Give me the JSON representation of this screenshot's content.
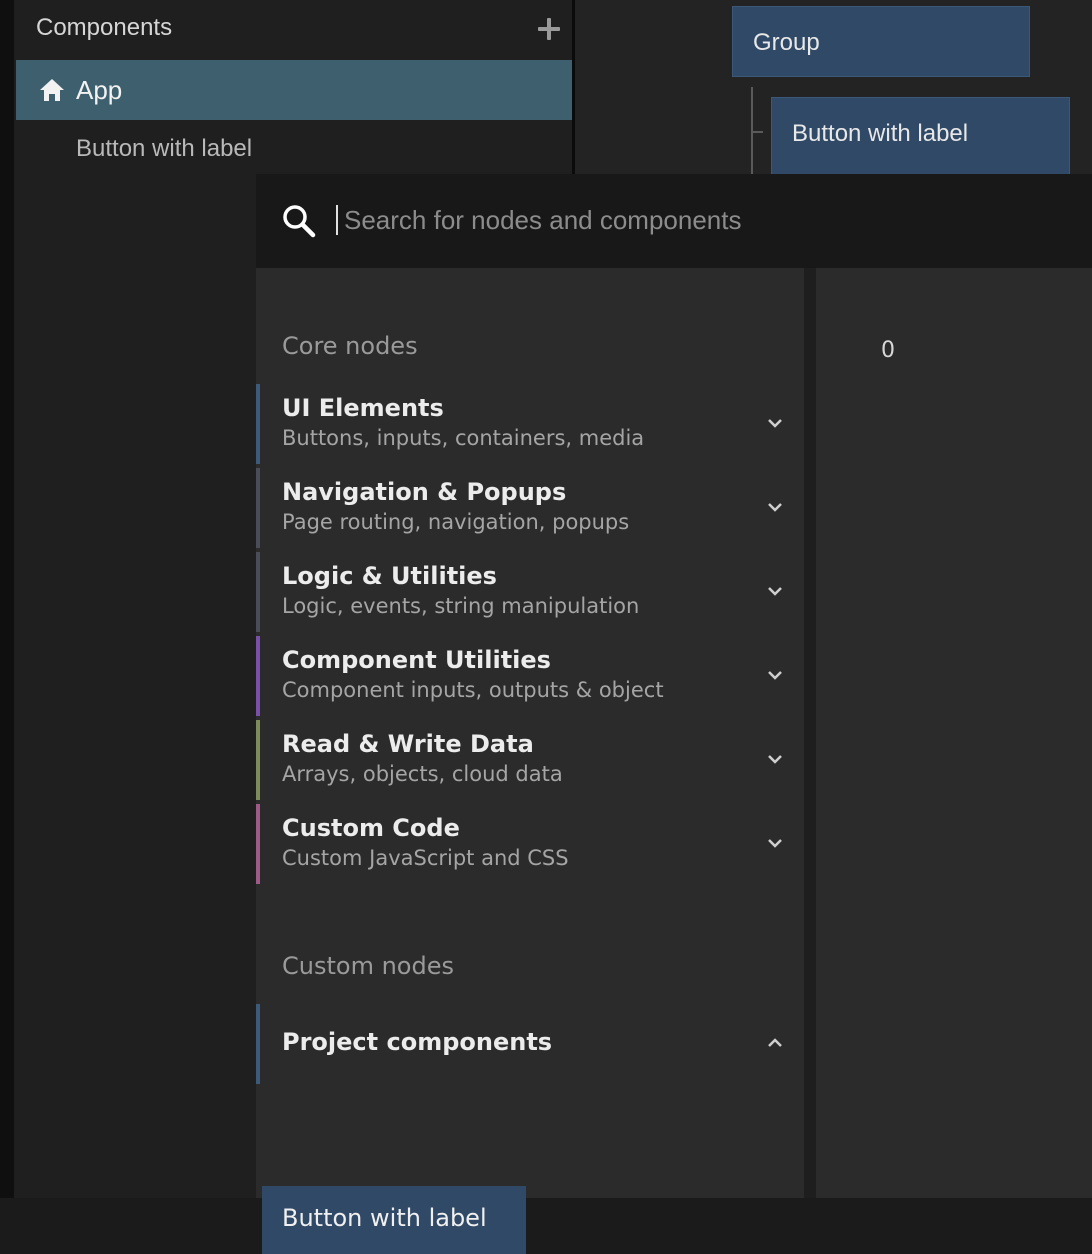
{
  "sidebar": {
    "title": "Components",
    "items": [
      {
        "label": "App",
        "icon": "home-icon",
        "selected": true
      },
      {
        "label": "Button with label"
      }
    ]
  },
  "canvas": {
    "nodes": [
      {
        "label": "Group"
      },
      {
        "label": "Button with label"
      }
    ]
  },
  "picker": {
    "search": {
      "placeholder": "Search for nodes and components",
      "value": ""
    },
    "sections": [
      {
        "label": "Core nodes",
        "categories": [
          {
            "title": "UI Elements",
            "subtitle": "Buttons, inputs, containers, media",
            "color": "#3d5a7a",
            "expanded": false
          },
          {
            "title": "Navigation & Popups",
            "subtitle": "Page routing, navigation, popups",
            "color": "#4a4d58",
            "expanded": false
          },
          {
            "title": "Logic & Utilities",
            "subtitle": "Logic, events, string manipulation",
            "color": "#4a4d58",
            "expanded": false
          },
          {
            "title": "Component Utilities",
            "subtitle": "Component inputs, outputs & object",
            "color": "#7a4fa8",
            "expanded": false
          },
          {
            "title": "Read & Write Data",
            "subtitle": "Arrays, objects, cloud data",
            "color": "#7e8c5c",
            "expanded": false
          },
          {
            "title": "Custom Code",
            "subtitle": "Custom JavaScript and CSS",
            "color": "#9c5a86",
            "expanded": false
          }
        ]
      },
      {
        "label": "Custom nodes",
        "categories": [
          {
            "title": "Project components",
            "color": "#3d5a7a",
            "expanded": true,
            "items": [
              "Button with label"
            ]
          }
        ]
      }
    ],
    "preview_value": "0"
  }
}
